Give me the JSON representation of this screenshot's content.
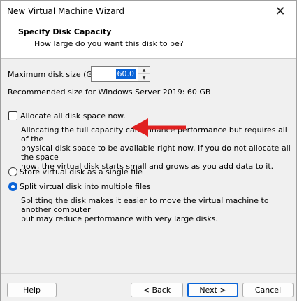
{
  "window": {
    "title": "New Virtual Machine Wizard"
  },
  "header": {
    "title": "Specify Disk Capacity",
    "subtitle": "How large do you want this disk to be?"
  },
  "disk": {
    "max_size_label": "Maximum disk size (GB):",
    "max_size_value": "60.0",
    "recommended": "Recommended size for Windows Server 2019: 60 GB"
  },
  "allocate": {
    "label": "Allocate all disk space now.",
    "checked": false,
    "desc_line1": "Allocating the full capacity can enhance performance but requires all of the",
    "desc_line2": "physical disk space to be available right now. If you do not allocate all the space",
    "desc_line3": "now, the virtual disk starts small and grows as you add data to it."
  },
  "storage": {
    "single_label": "Store virtual disk as a single file",
    "split_label": "Split virtual disk into multiple files",
    "selected": "split",
    "split_desc_line1": "Splitting the disk makes it easier to move the virtual machine to another computer",
    "split_desc_line2": "but may reduce performance with very large disks."
  },
  "footer": {
    "help": "Help",
    "back": "< Back",
    "next": "Next >",
    "cancel": "Cancel"
  },
  "colors": {
    "accent": "#0a64d8",
    "annotation_arrow": "#e02020"
  }
}
